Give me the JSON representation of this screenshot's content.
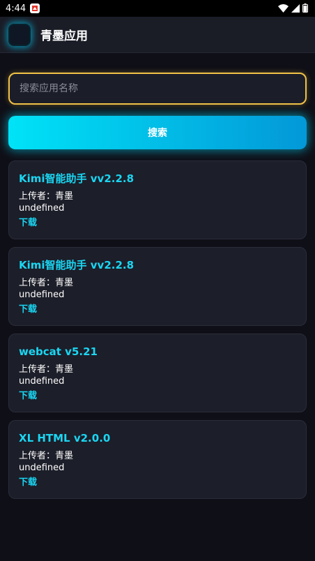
{
  "status_bar": {
    "time": "4:44"
  },
  "app_bar": {
    "title": "青墨应用"
  },
  "search": {
    "placeholder": "搜索应用名称",
    "button_label": "搜索"
  },
  "apps": [
    {
      "name": "Kimi智能助手 vv2.2.8",
      "uploader_label": "上传者：",
      "uploader": "青墨",
      "description": "undefined",
      "download_label": "下载"
    },
    {
      "name": "Kimi智能助手 vv2.2.8",
      "uploader_label": "上传者：",
      "uploader": "青墨",
      "description": "undefined",
      "download_label": "下载"
    },
    {
      "name": "webcat v5.21",
      "uploader_label": "上传者：",
      "uploader": "青墨",
      "description": "undefined",
      "download_label": "下载"
    },
    {
      "name": "XL HTML v2.0.0",
      "uploader_label": "上传者：",
      "uploader": "青墨",
      "description": "undefined",
      "download_label": "下载"
    }
  ],
  "colors": {
    "accent": "#1ad6f2",
    "input_border": "#f0c247",
    "background": "#0f0f17"
  }
}
